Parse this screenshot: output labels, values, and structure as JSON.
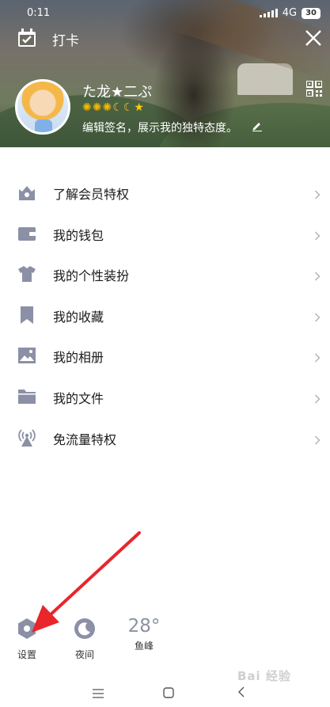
{
  "status_bar": {
    "time": "0:11",
    "network": "4G",
    "battery": "30"
  },
  "header": {
    "checkin_label": "打卡",
    "nickname": "た龙★二ぷ",
    "signature": "编辑签名，展示我的独特态度。"
  },
  "menu": [
    {
      "label": "了解会员特权",
      "icon": "crown-house-icon"
    },
    {
      "label": "我的钱包",
      "icon": "wallet-icon"
    },
    {
      "label": "我的个性装扮",
      "icon": "shirt-icon"
    },
    {
      "label": "我的收藏",
      "icon": "bookmark-icon"
    },
    {
      "label": "我的相册",
      "icon": "photo-icon"
    },
    {
      "label": "我的文件",
      "icon": "folder-icon"
    },
    {
      "label": "免流量特权",
      "icon": "antenna-icon"
    }
  ],
  "bottom": {
    "settings_label": "设置",
    "night_label": "夜间",
    "temperature": "28°",
    "city": "鱼峰"
  },
  "watermark": "Bai 经验",
  "colors": {
    "icon_gray": "#8b90a6",
    "arrow_red": "#e8262c"
  }
}
